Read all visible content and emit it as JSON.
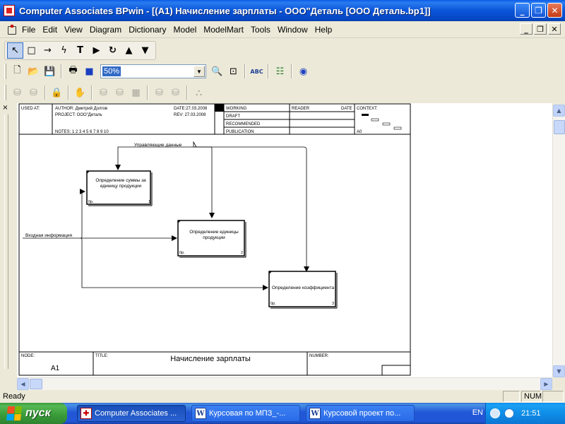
{
  "window": {
    "title": "Computer Associates BPwin - [(A1) Начисление зарплаты - ООО\"Деталь  [ООО Деталь.bp1]]",
    "minimize_glyph": "_",
    "restore_glyph": "❐",
    "close_glyph": "✕"
  },
  "menu": {
    "items": [
      "File",
      "Edit",
      "View",
      "Diagram",
      "Dictionary",
      "Model",
      "ModelMart",
      "Tools",
      "Window",
      "Help"
    ],
    "mdi_minimize": "_",
    "mdi_restore": "❐",
    "mdi_close": "✕"
  },
  "toolbar_tools": {
    "icons": [
      "pointer-icon",
      "box-icon",
      "arrow-icon",
      "squiggle-icon",
      "text-icon",
      "triangle-right-icon",
      "rotate-icon",
      "triangle-up-icon",
      "triangle-down-icon"
    ],
    "glyphs": [
      "↖",
      "□",
      "→",
      "ϟ",
      "T",
      "▶",
      "↻",
      "▲",
      "▼"
    ]
  },
  "toolbar_standard": {
    "zoom_value": "50%",
    "glyphs": {
      "new": "🗋",
      "open": "📂",
      "save": "💾",
      "print": "🖶",
      "colors": "■",
      "zoom_in": "🔍",
      "zoom_fit": "⊡",
      "spell": "ABC",
      "model_explorer": "☷",
      "modelmart": "◉"
    }
  },
  "toolbar_mart": {
    "glyphs": [
      "⛁",
      "⛁",
      "🔒",
      "✋",
      "⛁",
      "⛁",
      "▦",
      "⛁",
      "⛁",
      "⛬"
    ]
  },
  "workspace": {
    "side_close_glyph": "×",
    "scroll_up": "▲",
    "scroll_down": "▼",
    "scroll_left": "◀",
    "scroll_right": "▶"
  },
  "diagram": {
    "header": {
      "used_at_label": "USED AT:",
      "author": "AUTHOR: Дмитрий Долгов",
      "project": "PROJECT: ООО\"Деталь",
      "date": "DATE:27.03.2008",
      "rev": "REV:  27.03.2008",
      "notes": "NOTES: 1 2 3 4 5 6 7 8 9 10",
      "status_labels": [
        "WORKING",
        "DRAFT",
        "RECOMMENDED",
        "PUBLICATION"
      ],
      "reader": "READER",
      "date_label": "DATE",
      "context": "CONTEXT:",
      "context_node": "A0"
    },
    "boxes": [
      {
        "name": "Определение суммы за единицу продукции",
        "lines": [
          "Определение суммы за",
          "единицу продукции"
        ],
        "cost": "0р.",
        "number": "1"
      },
      {
        "name": "Определение единицы продукции",
        "lines": [
          "Определение единицы",
          "продукции"
        ],
        "cost": "0р.",
        "number": "2"
      },
      {
        "name": "Определение коэффициента",
        "lines": [
          "Определение коэффициента"
        ],
        "cost": "0р.",
        "number": "3"
      }
    ],
    "arrows": {
      "control": "Управляющие данные",
      "input": "Входная информация"
    },
    "footer": {
      "node_label": "NODE:",
      "node_value": "A1",
      "title_label": "TITLE:",
      "title_value": "Начисление зарплаты",
      "number_label": "NUMBER:"
    }
  },
  "status": {
    "ready": "Ready",
    "num": "NUM"
  },
  "taskbar": {
    "start": "пуск",
    "tasks": [
      {
        "label": "Computer Associates ...",
        "icon": "bp"
      },
      {
        "label": "Курсовая по  МПЗ_-...",
        "icon": "word"
      },
      {
        "label": "Курсовой проект по...",
        "icon": "word"
      }
    ],
    "lang": "EN",
    "clock": "21:51"
  }
}
